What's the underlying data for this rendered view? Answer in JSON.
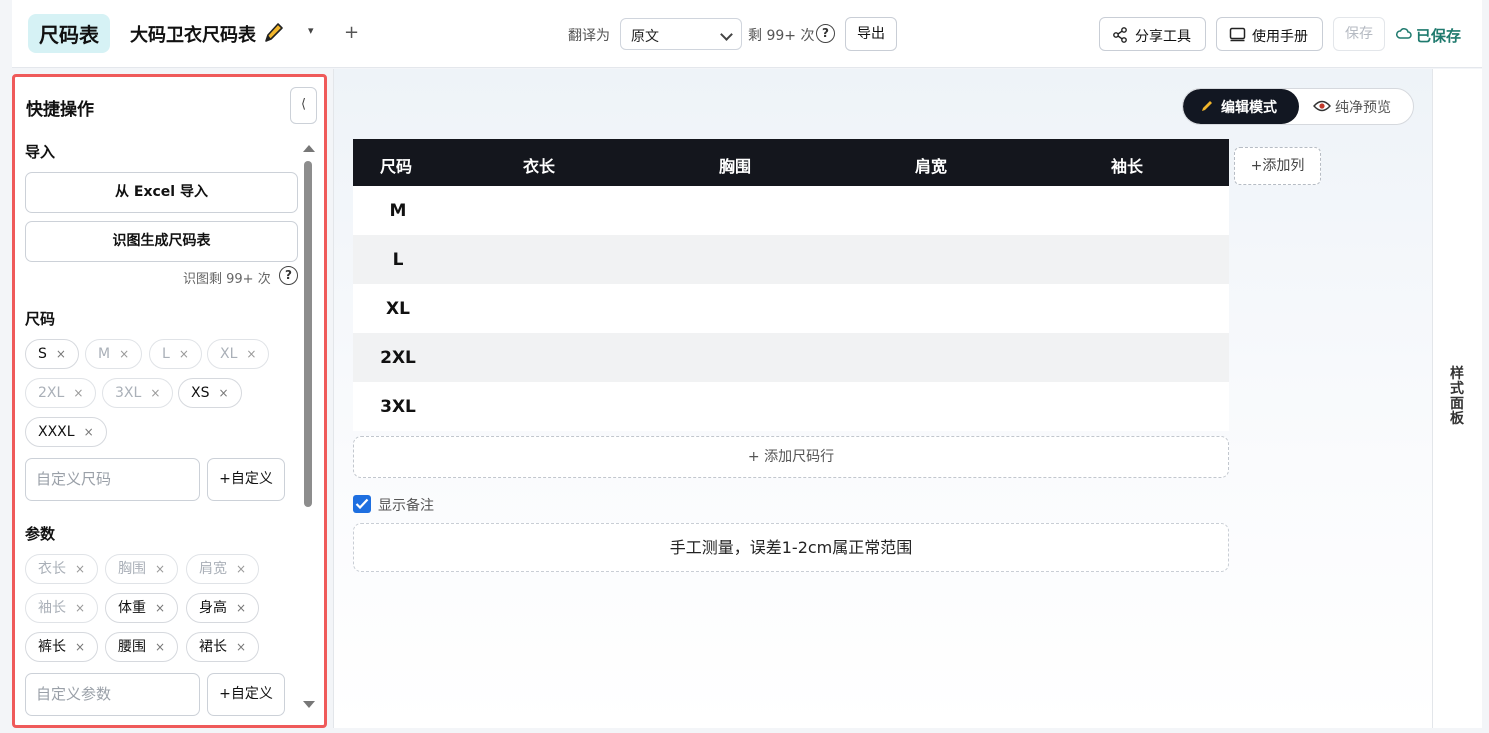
{
  "app": {
    "logo_text": "尺码表",
    "doc_title": "大码卫衣尺码表",
    "plus_label": "+",
    "caret_label": "▾"
  },
  "translate": {
    "label": "翻译为",
    "selected": "原文",
    "remaining": "剩 99+ 次",
    "help": "?"
  },
  "toolbar": {
    "export_label": "导出",
    "share_label": "分享工具",
    "manual_label": "使用手册",
    "save_label": "保存",
    "saved_status": "已保存"
  },
  "sidebar": {
    "title": "快捷操作",
    "collapse_label": "⟨",
    "import": {
      "title": "导入",
      "excel_button": "从 Excel 导入",
      "ocr_button": "识图生成尺码表",
      "ocr_remaining": "识图剩 99+ 次",
      "help": "?"
    },
    "sizes": {
      "title": "尺码",
      "chips": [
        {
          "label": "S",
          "active": true
        },
        {
          "label": "M",
          "active": false
        },
        {
          "label": "L",
          "active": false
        },
        {
          "label": "XL",
          "active": false
        },
        {
          "label": "2XL",
          "active": false
        },
        {
          "label": "3XL",
          "active": false
        },
        {
          "label": "XS",
          "active": true
        },
        {
          "label": "XXXL",
          "active": true
        }
      ],
      "custom_placeholder": "自定义尺码",
      "custom_button": "+自定义"
    },
    "params": {
      "title": "参数",
      "chips": [
        {
          "label": "衣长",
          "active": false
        },
        {
          "label": "胸围",
          "active": false
        },
        {
          "label": "肩宽",
          "active": false
        },
        {
          "label": "袖长",
          "active": false
        },
        {
          "label": "体重",
          "active": true
        },
        {
          "label": "身高",
          "active": true
        },
        {
          "label": "裤长",
          "active": true
        },
        {
          "label": "腰围",
          "active": true
        },
        {
          "label": "裙长",
          "active": true
        }
      ],
      "custom_placeholder": "自定义参数",
      "custom_button": "+自定义"
    },
    "chip_remove": "×"
  },
  "mode": {
    "edit_label": "编辑模式",
    "preview_label": "纯净预览"
  },
  "table": {
    "headers": [
      "尺码",
      "衣长",
      "胸围",
      "肩宽",
      "袖长"
    ],
    "rows": [
      "M",
      "L",
      "XL",
      "2XL",
      "3XL"
    ],
    "add_column": "+添加列",
    "add_row": "+ 添加尺码行"
  },
  "notes": {
    "show_label": "显示备注",
    "checked": true,
    "text": "手工测量，误差1-2cm属正常范围"
  },
  "right_rail": {
    "label": "样式面板"
  },
  "colors": {
    "accent_teal": "#d6f2f5",
    "saved_green": "#1f7a6e",
    "table_header": "#14161d",
    "highlight_border": "#ef5a5a",
    "checkbox_blue": "#1e6fe0"
  }
}
